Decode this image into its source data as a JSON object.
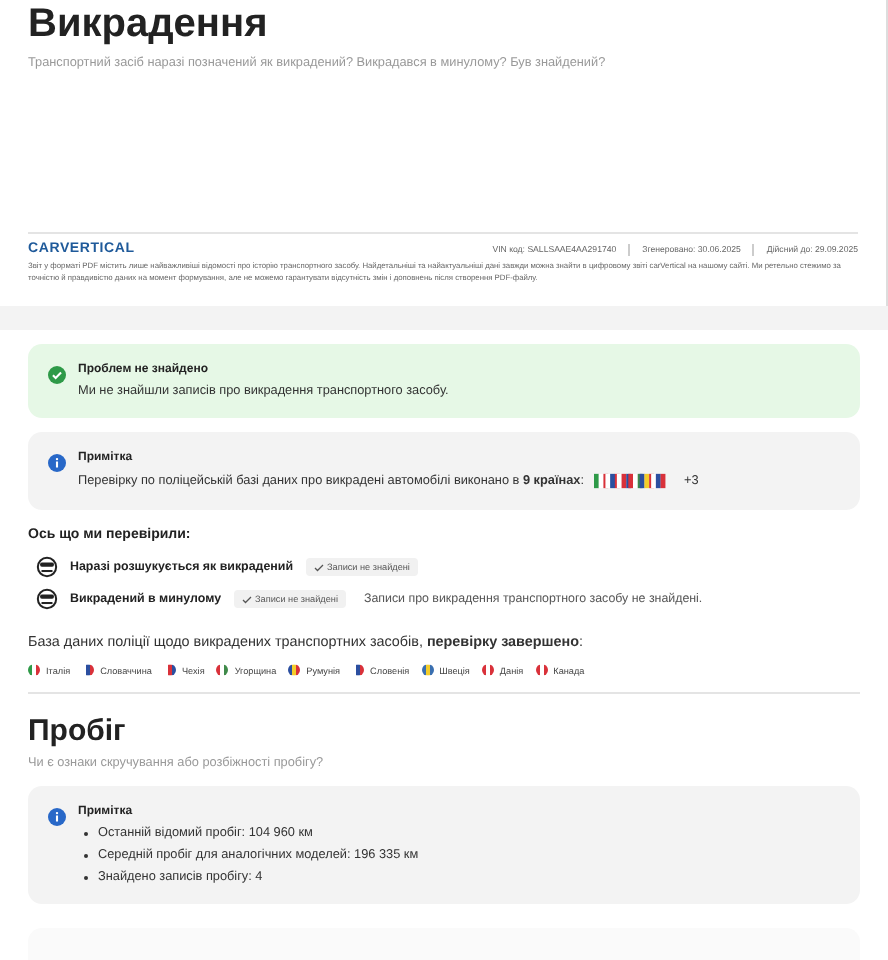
{
  "section": {
    "title": "Викрадення",
    "subtitle": "Транспортний засіб наразі позначений як викрадений? Викрадався в минулому? Був знайдений?"
  },
  "footer": {
    "logo": "CARVERTICAL",
    "vin": "VIN код: SALLSAAE4AA291740",
    "generated": "Згенеровано: 30.06.2025",
    "valid": "Дійсний до: 29.09.2025",
    "disclaimer": "Звіт у форматі PDF містить лише найважливіші відомості про історію транспортного засобу. Найдетальніші та найактуальніші дані завжди можна знайти в цифровому звіті carVertical на нашому сайті. Ми ретельно стежимо за точністю й правдивістю даних на момент формування, але не можемо гарантувати відсутність змін і доповнень після створення PDF-файлу."
  },
  "status_card": {
    "kind": "success",
    "title": "Проблем не знайдено",
    "text": "Ми не знайшли записів про викрадення транспортного засобу."
  },
  "note_card": {
    "kind": "info",
    "title": "Примітка",
    "text": "Перевірку по поліцейській базі даних про викрадені автомобілі виконано в **9 країнах**:",
    "more": "+3"
  },
  "checks_heading": "Ось що ми перевірили:",
  "checks": [
    {
      "label": "Наразі розшукується як викрадений",
      "status": "Записи не знайдені"
    },
    {
      "label": "Викрадений в минулому",
      "status": "Записи не знайдені",
      "note": "Записи про викрадення транспортного засобу не знайдені."
    }
  ],
  "database_text": "База даних поліції щодо викрадених транспортних засобів, **перевірку завершено**:",
  "countries": [
    "Італія",
    "Словаччина",
    "Чехія",
    "Угорщина",
    "Румунія",
    "Словенія",
    "Швеція",
    "Данія",
    "Канада"
  ],
  "mileage": {
    "title": "Пробіг",
    "subtitle": "Чи є ознаки скручування або розбіжності пробігу?",
    "note": {
      "kind": "info",
      "title": "Примітка",
      "items": [
        "Останній відомий пробіг: 104 960 км",
        "Середній пробіг для аналогічних моделей: 196 335 км",
        "Знайдено записів пробігу: 4"
      ]
    }
  }
}
